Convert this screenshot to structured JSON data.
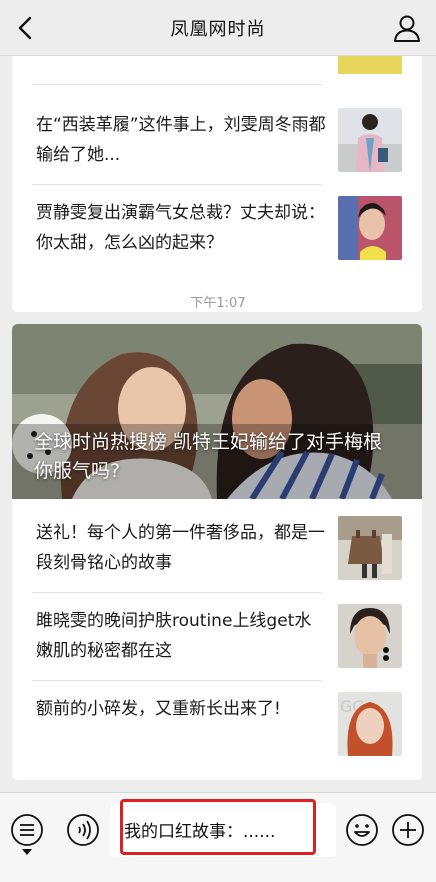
{
  "nav": {
    "title": "凤凰网时尚",
    "back_icon": "chevron-left-icon",
    "user_icon": "person-icon"
  },
  "feed": {
    "card1": {
      "items": [
        {
          "text": "在“西装革履”这件事上，刘雯周冬雨都输给了她..."
        },
        {
          "text": "贾静雯复出演霸气女总裁？丈夫却说：你太甜，怎么凶的起来？"
        }
      ]
    },
    "time_label": "下午1:07",
    "card2": {
      "hero_title": "全球时尚热搜榜 凯特王妃输给了对手梅根 你服气吗?",
      "items": [
        {
          "text": "送礼！每个人的第一件奢侈品，都是一段刻骨铭心的故事"
        },
        {
          "text": "雎晓雯的晚间护肤routine上线get水嫩肌的秘密都在这"
        },
        {
          "text": "额前的小碎发，又重新长出来了!"
        }
      ]
    }
  },
  "bottom_bar": {
    "menu_icon": "menu-list-icon",
    "voice_icon": "voice-icon",
    "input_text": "我的口红故事：......",
    "emoji_icon": "smiley-icon",
    "plus_icon": "plus-circle-icon",
    "highlight_color": "#e02020"
  }
}
